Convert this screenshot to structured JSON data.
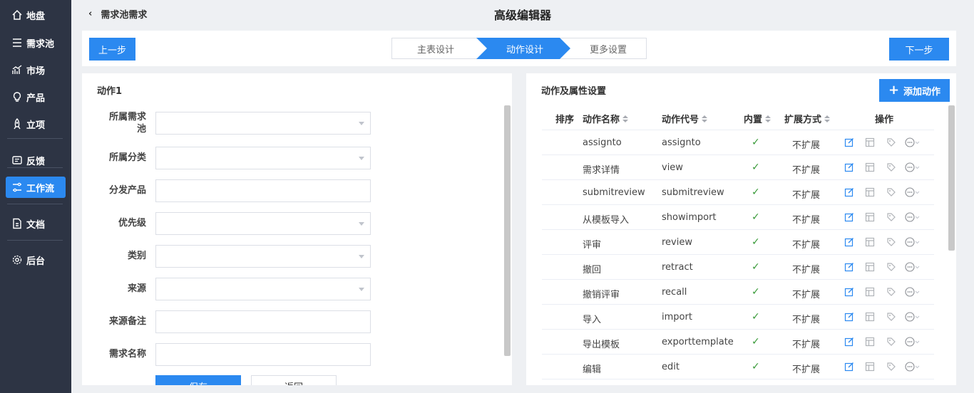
{
  "sidebar": {
    "items": [
      {
        "label": "地盘",
        "icon": "home-icon"
      },
      {
        "label": "需求池",
        "icon": "menu-lines-icon"
      },
      {
        "label": "市场",
        "icon": "chart-trend-icon"
      },
      {
        "label": "产品",
        "icon": "lightbulb-icon"
      },
      {
        "label": "立项",
        "icon": "rocket-icon"
      },
      {
        "label": "反馈",
        "icon": "feedback-icon"
      },
      {
        "label": "工作流",
        "icon": "workflow-icon"
      },
      {
        "label": "文档",
        "icon": "document-icon"
      },
      {
        "label": "后台",
        "icon": "gear-icon"
      }
    ],
    "active": "工作流"
  },
  "header": {
    "back_label": "需求池需求",
    "title": "高级编辑器"
  },
  "stepbar": {
    "prev_label": "上一步",
    "next_label": "下一步",
    "steps": [
      "主表设计",
      "动作设计",
      "更多设置"
    ],
    "active_step": "动作设计"
  },
  "left_panel": {
    "title": "动作1",
    "fields": [
      {
        "label": "所属需求池",
        "type": "select",
        "value": ""
      },
      {
        "label": "所属分类",
        "type": "select",
        "value": ""
      },
      {
        "label": "分发产品",
        "type": "text",
        "value": ""
      },
      {
        "label": "优先级",
        "type": "select",
        "value": ""
      },
      {
        "label": "类别",
        "type": "select",
        "value": ""
      },
      {
        "label": "来源",
        "type": "select",
        "value": ""
      },
      {
        "label": "来源备注",
        "type": "text",
        "value": ""
      },
      {
        "label": "需求名称",
        "type": "text",
        "value": ""
      }
    ],
    "save_label": "保存",
    "back_label": "返回"
  },
  "right_panel": {
    "title": "动作及属性设置",
    "add_label": "添加动作",
    "columns": [
      "排序",
      "动作名称",
      "动作代号",
      "内置",
      "扩展方式",
      "操作"
    ],
    "rows": [
      {
        "name": "assignto",
        "code": "assignto",
        "builtin": true,
        "extend": "不扩展"
      },
      {
        "name": "需求详情",
        "code": "view",
        "builtin": true,
        "extend": "不扩展"
      },
      {
        "name": "submitreview",
        "code": "submitreview",
        "builtin": true,
        "extend": "不扩展"
      },
      {
        "name": "从模板导入",
        "code": "showimport",
        "builtin": true,
        "extend": "不扩展"
      },
      {
        "name": "评审",
        "code": "review",
        "builtin": true,
        "extend": "不扩展"
      },
      {
        "name": "撤回",
        "code": "retract",
        "builtin": true,
        "extend": "不扩展"
      },
      {
        "name": "撤销评审",
        "code": "recall",
        "builtin": true,
        "extend": "不扩展"
      },
      {
        "name": "导入",
        "code": "import",
        "builtin": true,
        "extend": "不扩展"
      },
      {
        "name": "导出模板",
        "code": "exporttemplate",
        "builtin": true,
        "extend": "不扩展"
      },
      {
        "name": "编辑",
        "code": "edit",
        "builtin": true,
        "extend": "不扩展"
      }
    ]
  },
  "colors": {
    "sidebar_bg": "#2d3444",
    "accent": "#2b89f0",
    "check": "#3a9b3a"
  }
}
